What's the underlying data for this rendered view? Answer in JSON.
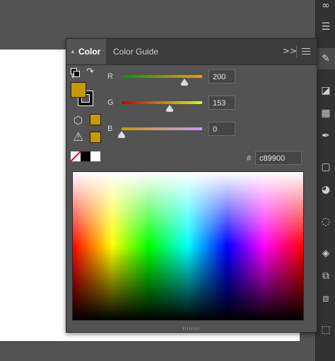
{
  "panel": {
    "tabs": [
      {
        "label": "Color",
        "active": true
      },
      {
        "label": "Color Guide",
        "active": false
      }
    ],
    "collapse_icon": "double-chevron-right-icon",
    "menu_icon": "hamburger-menu-icon",
    "sort_icon": "up-down-arrows-icon"
  },
  "color": {
    "fill_hex_color": "#c89900",
    "stroke_hex_color": "#000000",
    "sliders": [
      {
        "channel": "R",
        "value": "200",
        "fraction": 0.784
      },
      {
        "channel": "G",
        "value": "153",
        "fraction": 0.6
      },
      {
        "channel": "B",
        "value": "0",
        "fraction": 0.0
      }
    ],
    "hex_prefix": "#",
    "hex_value": "c89900"
  },
  "right_toolbar": {
    "icons": [
      "link-icon",
      "properties-icon",
      "color-palette-icon",
      "gradient-icon",
      "swatches-icon",
      "brushes-icon",
      "transparency-icon",
      "color-themes-icon",
      "stroke-icon",
      "layers-icon",
      "align-icon",
      "pathfinder-icon",
      "transform-icon"
    ]
  }
}
